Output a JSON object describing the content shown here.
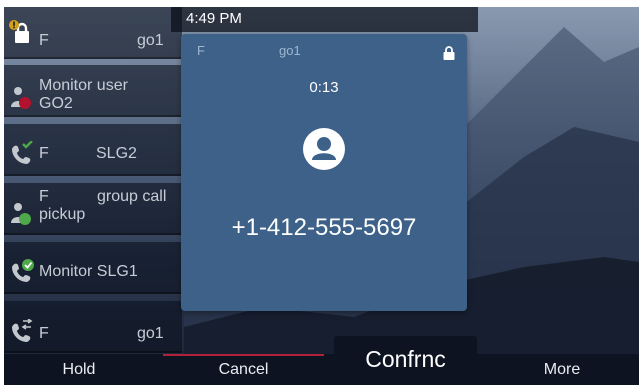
{
  "status_bar": {
    "time": "4:49 PM"
  },
  "line_keys": [
    {
      "label": "F",
      "extension": "go1",
      "icon": "lock-icon",
      "badge_icon": "alert-badge-icon"
    },
    {
      "label": "Monitor user",
      "label2": "GO2",
      "icon": "monitor-user-busy-icon"
    },
    {
      "label": "F",
      "extension": "SLG2",
      "icon": "shared-line-icon"
    },
    {
      "label": "F",
      "extension": "group call",
      "label2": "pickup",
      "icon": "group-pickup-icon"
    },
    {
      "label": "Monitor SLG1",
      "icon": "shared-line-check-icon"
    },
    {
      "label": "F",
      "extension": "go1",
      "icon": "phone-transfer-icon"
    }
  ],
  "call": {
    "line_label": "F",
    "line_name": "go1",
    "timer": "0:13",
    "number": "+1-412-555-5697",
    "lock_icon": "lock-icon",
    "avatar_icon": "contact-avatar-icon"
  },
  "softkeys": {
    "hold": "Hold",
    "cancel": "Cancel",
    "conference": "Confrnc",
    "more": "More"
  },
  "colors": {
    "panel": "#3d6189",
    "softkey_active": "#b1213a",
    "alert_badge": "#d4a017",
    "busy": "#b3122e",
    "idle": "#4fa84a"
  }
}
